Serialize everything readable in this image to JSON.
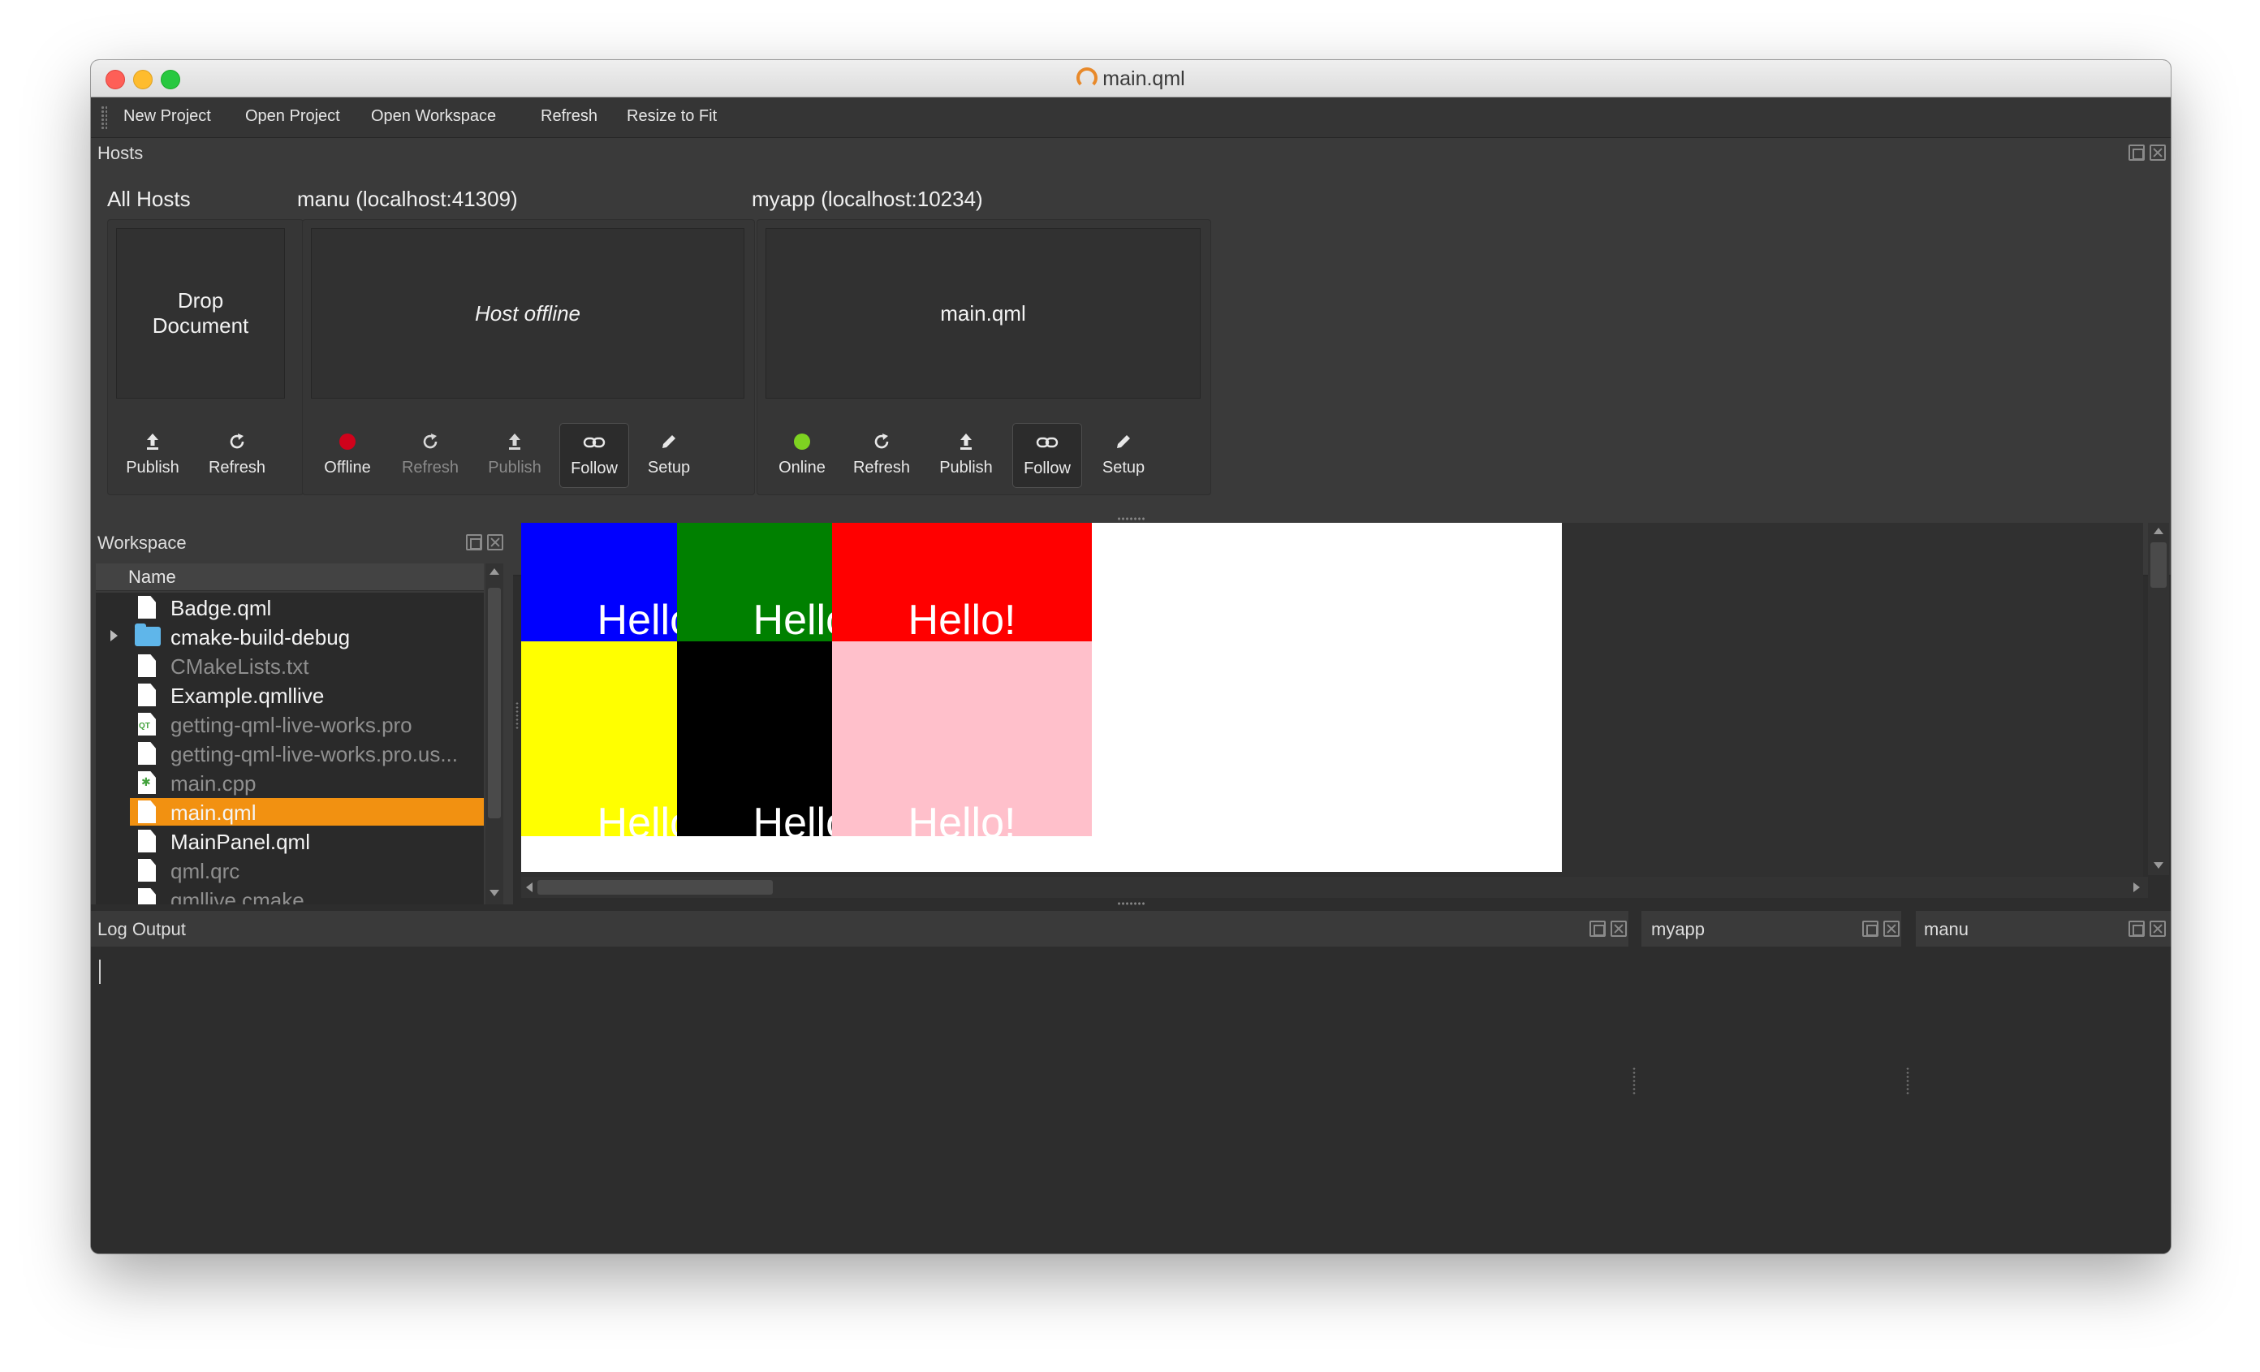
{
  "window": {
    "title": "main.qml"
  },
  "toolbar": {
    "new_project": "New Project",
    "open_project": "Open Project",
    "open_workspace": "Open Workspace",
    "refresh": "Refresh",
    "resize_to_fit": "Resize to Fit"
  },
  "hosts": {
    "title": "Hosts",
    "all_hosts": {
      "label": "All Hosts",
      "preview": "Drop Document",
      "actions": [
        "Publish",
        "Refresh"
      ]
    },
    "manu": {
      "label": "manu (localhost:41309)",
      "preview": "Host offline",
      "status": "Offline",
      "status_color": "#d0021b",
      "actions": [
        "Offline",
        "Refresh",
        "Publish",
        "Follow",
        "Setup"
      ]
    },
    "myapp": {
      "label": "myapp (localhost:10234)",
      "preview": "main.qml",
      "status": "Online",
      "status_color": "#7ed321",
      "actions": [
        "Online",
        "Refresh",
        "Publish",
        "Follow",
        "Setup"
      ]
    }
  },
  "workspace": {
    "title": "Workspace",
    "column_header": "Name",
    "items": [
      {
        "name": "Badge.qml",
        "type": "file",
        "dim": false
      },
      {
        "name": "cmake-build-debug",
        "type": "folder",
        "dim": false
      },
      {
        "name": "CMakeLists.txt",
        "type": "file",
        "dim": true
      },
      {
        "name": "Example.qmllive",
        "type": "file",
        "dim": false
      },
      {
        "name": "getting-qml-live-works.pro",
        "type": "pro",
        "dim": true
      },
      {
        "name": "getting-qml-live-works.pro.us...",
        "type": "file",
        "dim": true
      },
      {
        "name": "main.cpp",
        "type": "cpp",
        "dim": true
      },
      {
        "name": "main.qml",
        "type": "file",
        "dim": false,
        "selected": true
      },
      {
        "name": "MainPanel.qml",
        "type": "file",
        "dim": false
      },
      {
        "name": "qml.qrc",
        "type": "file",
        "dim": true
      },
      {
        "name": "qmllive.cmake",
        "type": "file",
        "dim": true
      }
    ]
  },
  "preview": {
    "tiles": [
      {
        "text": "Hello!",
        "color": "#0000ff"
      },
      {
        "text": "Hello!",
        "color": "#008000"
      },
      {
        "text": "Hello!",
        "color": "#ff0000"
      },
      {
        "text": "Hello!",
        "color": "#ffff00"
      },
      {
        "text": "Hello!",
        "color": "#000000"
      },
      {
        "text": "Hello!",
        "color": "#ffc0cb"
      }
    ]
  },
  "log": {
    "title": "Log Output"
  },
  "docks": {
    "myapp": "myapp",
    "manu": "manu"
  },
  "colors": {
    "accent": "#f29111",
    "panel": "#3a3a3a",
    "background": "#2d2d2d"
  }
}
